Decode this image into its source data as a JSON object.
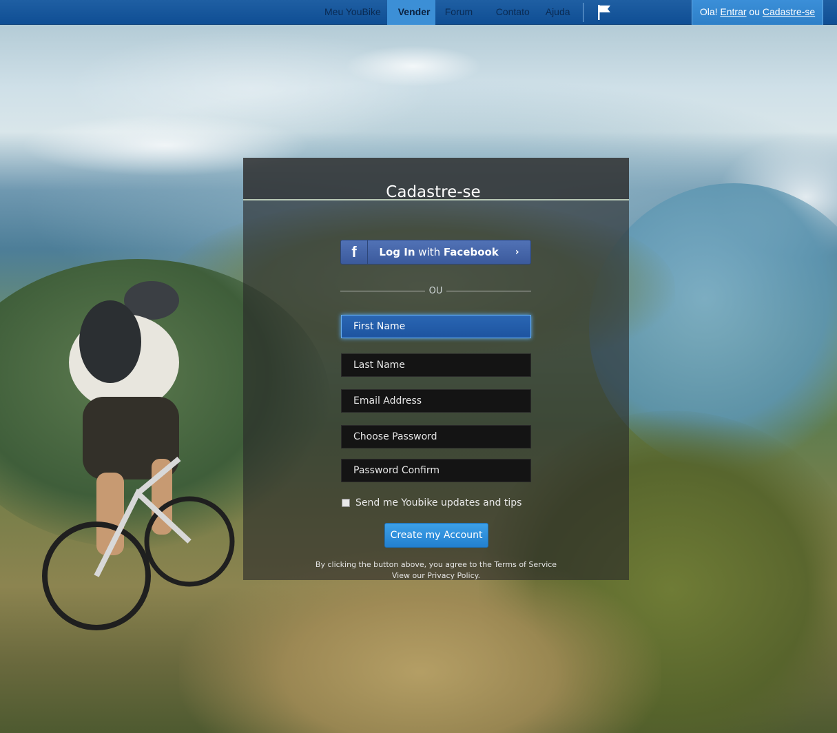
{
  "nav": {
    "items": [
      {
        "label": "Meu YouBike"
      },
      {
        "label": "Vender"
      },
      {
        "label": "Forum"
      },
      {
        "label": "Contato"
      },
      {
        "label": "Ajuda"
      }
    ],
    "active": "Vender",
    "flag_icon": "flag-icon"
  },
  "user": {
    "greeting": "Ola!",
    "login_link": "Entrar",
    "or_text": "ou",
    "signup_link": "Cadastre-se"
  },
  "card": {
    "title": "Cadastre-se",
    "facebook": {
      "icon": "f",
      "prefix": "Log In",
      "middle": "with",
      "brand": "Facebook",
      "chevron": "›"
    },
    "divider_text": "OU",
    "fields": {
      "first_name": "First Name",
      "last_name": "Last Name",
      "email": "Email Address",
      "password": "Choose Password",
      "password_confirm": "Password Confirm"
    },
    "checkbox_label": "Send me Youbike updates and tips",
    "submit_label": "Create my Account",
    "terms_line1": "By clicking the button above, you agree to the Terms of Service",
    "terms_line2": "View our Privacy Policy."
  },
  "colors": {
    "topbar": "#0f4e94",
    "active_tab": "#3c8fd6",
    "facebook": "#3b5a9c",
    "submit": "#2280d0"
  }
}
